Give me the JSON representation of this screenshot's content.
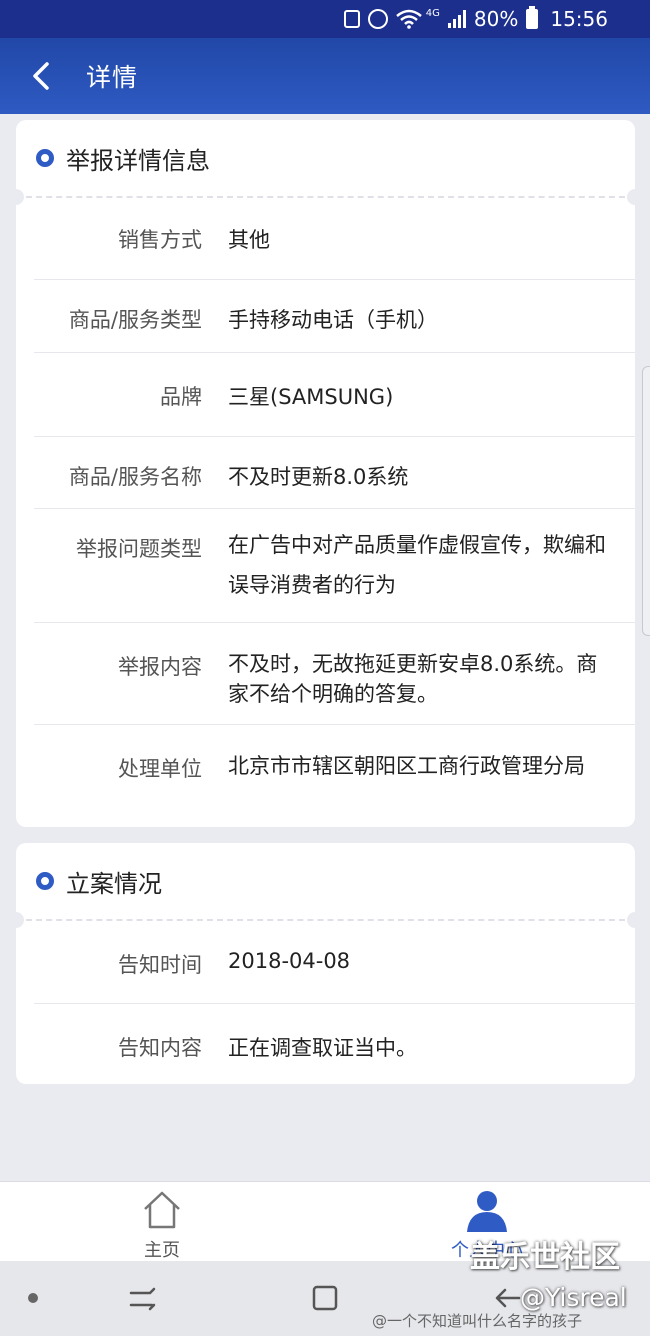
{
  "status_bar": {
    "battery": "80%",
    "time": "15:56",
    "network": "4G"
  },
  "header": {
    "title": "详情"
  },
  "report": {
    "title": "举报详情信息",
    "rows": [
      {
        "label": "销售方式",
        "value": "其他"
      },
      {
        "label": "商品/服务类型",
        "value": "手持移动电话（手机）"
      },
      {
        "label": "品牌",
        "value": "三星(SAMSUNG)"
      },
      {
        "label": "商品/服务名称",
        "value": "不及时更新8.0系统"
      },
      {
        "label": "举报问题类型",
        "value": "在广告中对产品质量作虚假宣传，欺编和误导消费者的行为"
      },
      {
        "label": "举报内容",
        "value": "不及时，无故拖延更新安卓8.0系统。商家不给个明确的答复。"
      },
      {
        "label": "处理单位",
        "value": "北京市市辖区朝阳区工商行政管理分局"
      }
    ]
  },
  "case": {
    "title": "立案情况",
    "rows": [
      {
        "label": "告知时间",
        "value": "2018-04-08"
      },
      {
        "label": "告知内容",
        "value": "正在调查取证当中。"
      }
    ]
  },
  "bottom_nav": {
    "home_label": "主页",
    "me_label": "个人中心"
  },
  "watermark": {
    "brand": "盖乐世社区",
    "handle": "@Yisreal",
    "weibo": "@一个不知道叫什么名字的孩子"
  },
  "colors": {
    "accent": "#2f5bc4",
    "header": "#2148a8",
    "status_bar": "#1c2f8c"
  }
}
